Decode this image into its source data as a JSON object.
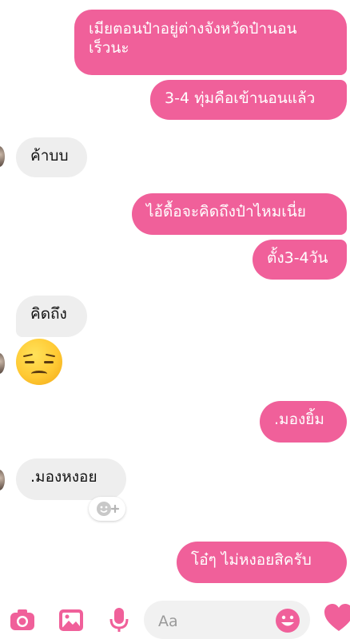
{
  "colors": {
    "accent": "#f0609a",
    "incoming_bubble": "#eeeeee"
  },
  "messages": [
    {
      "side": "out",
      "text": "เมียตอนป๋าอยู่ต่างจังหวัดป๋านอน\nเร็วนะ"
    },
    {
      "side": "out",
      "text": "3-4 ทุ่มคือเข้านอนแล้ว"
    },
    {
      "side": "in",
      "text": "ค้าบบ"
    },
    {
      "side": "out",
      "text": "ไอ้ดื้อจะคิดถึงป๋าไหมเนี่ย"
    },
    {
      "side": "out",
      "text": "ตั้ง3-4วัน"
    },
    {
      "side": "in",
      "text": "คิดถึง"
    },
    {
      "side": "in",
      "emoji": "disappointed-face"
    },
    {
      "side": "out",
      "text": ".มองยิ้ม"
    },
    {
      "side": "in",
      "text": ".มองหงอย"
    },
    {
      "side": "out",
      "text": "โอ๋ๆ ไม่หงอยสิครับ"
    }
  ],
  "composer": {
    "placeholder": "Aa",
    "icons": [
      "camera-icon",
      "gallery-icon",
      "microphone-icon",
      "emoji-icon",
      "heart-icon"
    ]
  }
}
